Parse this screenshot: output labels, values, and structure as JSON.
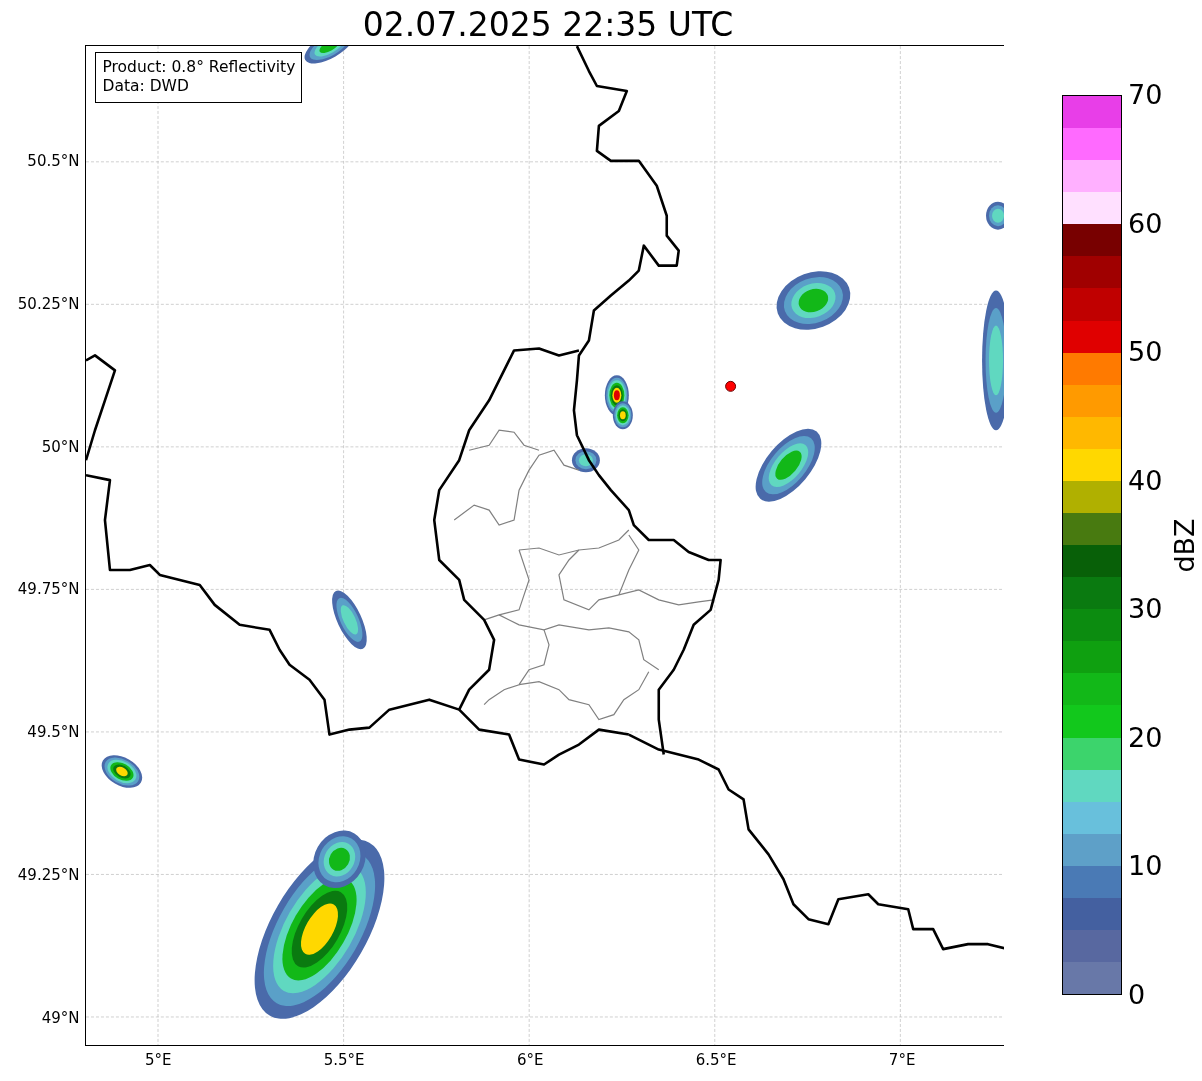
{
  "title": "02.07.2025 22:35 UTC",
  "info_box": {
    "lines": [
      "Product: 0.8° Reflectivity",
      "Data: DWD"
    ]
  },
  "map": {
    "xticks": [
      "5°E",
      "5.5°E",
      "6°E",
      "6.5°E",
      "7°E"
    ],
    "yticks": [
      "50.5°N",
      "50.25°N",
      "50°N",
      "49.75°N",
      "49.5°N",
      "49.25°N",
      "49°N"
    ]
  },
  "colorbar": {
    "label": "dBZ",
    "ticks": [
      "70",
      "60",
      "50",
      "40",
      "30",
      "20",
      "10",
      "0"
    ],
    "segments": [
      {
        "color": "#e83ee8"
      },
      {
        "color": "#ff6aff"
      },
      {
        "color": "#ffb0ff"
      },
      {
        "color": "#ffe0ff"
      },
      {
        "color": "#780000"
      },
      {
        "color": "#a00000"
      },
      {
        "color": "#c00000"
      },
      {
        "color": "#e00000"
      },
      {
        "color": "#ff7a00"
      },
      {
        "color": "#ff9a00"
      },
      {
        "color": "#ffb800"
      },
      {
        "color": "#ffd800"
      },
      {
        "color": "#b0b000"
      },
      {
        "color": "#487a10"
      },
      {
        "color": "#086008"
      },
      {
        "color": "#0a7a10"
      },
      {
        "color": "#0c8c10"
      },
      {
        "color": "#0fa010"
      },
      {
        "color": "#12b818"
      },
      {
        "color": "#12c81c"
      },
      {
        "color": "#3cd46c"
      },
      {
        "color": "#60d8c0"
      },
      {
        "color": "#68c0dc"
      },
      {
        "color": "#5ea0c8"
      },
      {
        "color": "#4a7ab5"
      },
      {
        "color": "#4460a0"
      },
      {
        "color": "#5868a0"
      },
      {
        "color": "#6878a8"
      }
    ]
  }
}
